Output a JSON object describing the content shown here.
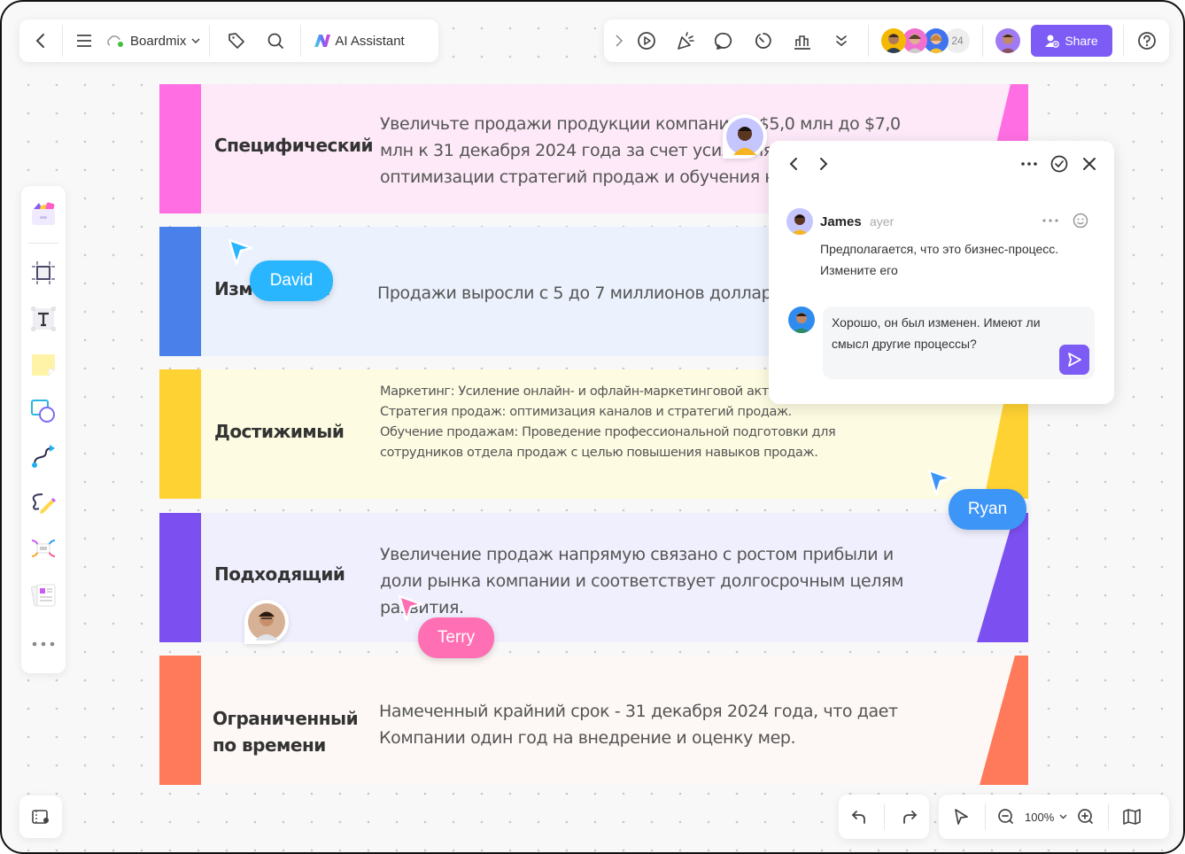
{
  "toolbar_left": {
    "back_icon": "chevron-left-icon",
    "menu_icon": "hamburger-menu-icon",
    "brand_label": "Boardmix",
    "cloud_icon": "cloud-sync-icon",
    "tag_icon": "tag-icon",
    "search_icon": "search-icon",
    "ai_label": "AI Assistant"
  },
  "toolbar_right": {
    "tools": [
      "expand-icon",
      "present-play-icon",
      "celebrate-icon",
      "comment-icon",
      "timer-icon",
      "vote-chart-icon",
      "more-chevrons-icon"
    ],
    "collaborator_count": "24",
    "share_label": "Share",
    "help_icon": "help-icon"
  },
  "left_rail": {
    "tools": [
      "templates",
      "frame",
      "text",
      "sticky-note",
      "shapes",
      "connector",
      "pen",
      "mind-map",
      "document",
      "more"
    ]
  },
  "rows": [
    {
      "label": "Специфический",
      "color": "#ff6fe3",
      "bg": "#fde9f8",
      "lines": [
        "Увеличьте продажи продукции компании с $5,0 млн до $7,0",
        "млн к 31 декабря 2024 года за счет усиления маркетинга,",
        "оптимизации стратегий продаж и обучения навыкам продаж."
      ]
    },
    {
      "label": "Измеримый",
      "color": "#4a80ea",
      "bg": "#ebf1fd",
      "lines": [
        "Продажи выросли с 5 до 7 миллионов долларов."
      ]
    },
    {
      "label": "Достижимый",
      "color": "#ffd234",
      "bg": "#fdfbe1",
      "lines": [
        "Маркетинг: Усиление онлайн- и офлайн-маркетинговой активности.",
        "Стратегия продаж: оптимизация каналов и стратегий продаж.",
        "Обучение продажам: Проведение профессиональной подготовки для",
        "сотрудников отдела продаж с целью повышения навыков продаж."
      ]
    },
    {
      "label": "Подходящий",
      "color": "#7c4ff0",
      "bg": "#f0effd",
      "lines": [
        "Увеличение продаж напрямую связано с ростом прибыли и",
        "доли рынка компании и соответствует долгосрочным целям",
        "развития."
      ]
    },
    {
      "label_lines": [
        "Ограниченный",
        "по времени"
      ],
      "color": "#ff7a5a",
      "bg": "#fdf8f5",
      "lines": [
        "Намеченный крайний срок - 31 декабря 2024 года, что дает",
        "Компании один год на внедрение и оценку мер."
      ]
    }
  ],
  "cursors": [
    {
      "name": "David",
      "color": "#29b6ff"
    },
    {
      "name": "Ryan",
      "color": "#3d95f7"
    },
    {
      "name": "Terry",
      "color": "#ff6fb3"
    }
  ],
  "comment_panel": {
    "author": "James",
    "time": "ayer",
    "message_lines": [
      "Предполагается, что это бизнес-процесс.",
      "Измените его"
    ],
    "reply_lines": [
      "Хорошо, он был изменен. Имеют ли",
      "смысл другие процессы?"
    ]
  },
  "bottom_bar": {
    "zoom_level": "100%"
  }
}
